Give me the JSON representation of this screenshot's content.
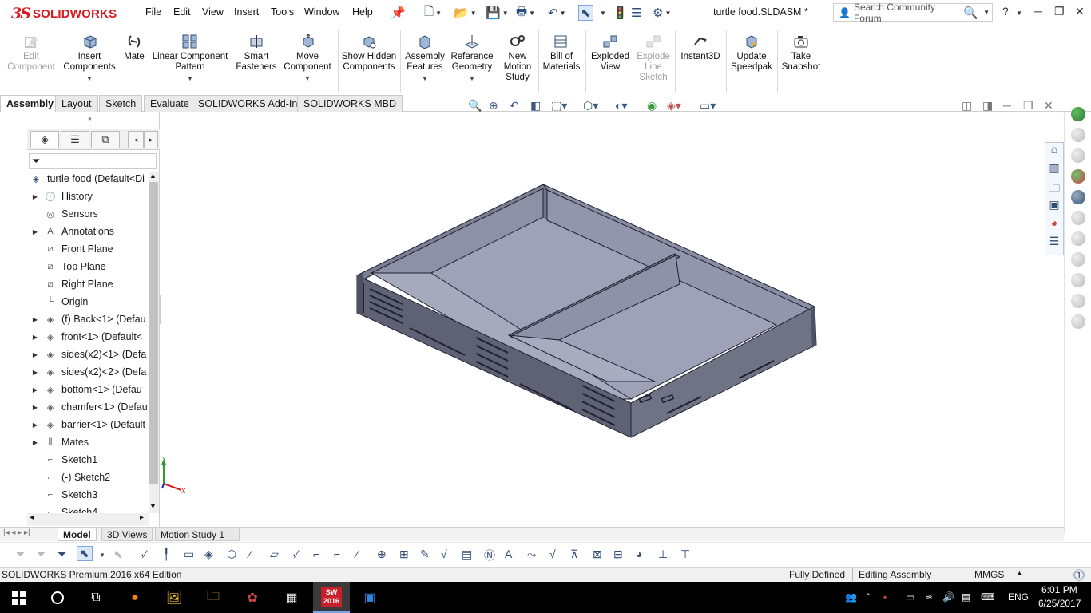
{
  "app": {
    "brand": "SOLIDWORKS",
    "document_title": "turtle food.SLDASM *"
  },
  "menu": [
    "File",
    "Edit",
    "View",
    "Insert",
    "Tools",
    "Window",
    "Help"
  ],
  "search": {
    "placeholder": "Search Community Forum"
  },
  "ribbon": [
    {
      "label": "Edit Component",
      "icon": "edit-component-icon",
      "enabled": false
    },
    {
      "label": "Insert Components",
      "icon": "insert-components-icon",
      "enabled": true
    },
    {
      "label": "Mate",
      "icon": "mate-icon",
      "enabled": true
    },
    {
      "label": "Linear Component Pattern",
      "icon": "pattern-icon",
      "enabled": true
    },
    {
      "label": "Smart Fasteners",
      "icon": "smart-fasteners-icon",
      "enabled": true
    },
    {
      "label": "Move Component",
      "icon": "move-component-icon",
      "enabled": true
    },
    {
      "label": "Show Hidden Components",
      "icon": "show-hidden-icon",
      "enabled": true
    },
    {
      "label": "Assembly Features",
      "icon": "assembly-features-icon",
      "enabled": true
    },
    {
      "label": "Reference Geometry",
      "icon": "reference-geometry-icon",
      "enabled": true
    },
    {
      "label": "New Motion Study",
      "icon": "motion-study-icon",
      "enabled": true
    },
    {
      "label": "Bill of Materials",
      "icon": "bom-icon",
      "enabled": true
    },
    {
      "label": "Exploded View",
      "icon": "exploded-view-icon",
      "enabled": true
    },
    {
      "label": "Explode Line Sketch",
      "icon": "explode-line-icon",
      "enabled": false
    },
    {
      "label": "Instant3D",
      "icon": "instant3d-icon",
      "enabled": true
    },
    {
      "label": "Update Speedpak",
      "icon": "speedpak-icon",
      "enabled": true
    },
    {
      "label": "Take Snapshot",
      "icon": "camera-icon",
      "enabled": true
    }
  ],
  "command_tabs": [
    "Assembly",
    "Layout",
    "Sketch",
    "Evaluate",
    "SOLIDWORKS Add-Ins",
    "SOLIDWORKS MBD"
  ],
  "feature_tree": {
    "root": "turtle food  (Default<Di",
    "items": [
      {
        "label": "History",
        "icon": "history-icon",
        "expandable": true
      },
      {
        "label": "Sensors",
        "icon": "sensors-icon",
        "expandable": false
      },
      {
        "label": "Annotations",
        "icon": "annotations-icon",
        "expandable": true
      },
      {
        "label": "Front Plane",
        "icon": "plane-icon",
        "expandable": false
      },
      {
        "label": "Top Plane",
        "icon": "plane-icon",
        "expandable": false
      },
      {
        "label": "Right Plane",
        "icon": "plane-icon",
        "expandable": false
      },
      {
        "label": "Origin",
        "icon": "origin-icon",
        "expandable": false
      },
      {
        "label": "(f) Back<1> (Defau",
        "icon": "part-icon",
        "expandable": true
      },
      {
        "label": "front<1> (Default<",
        "icon": "part-icon",
        "expandable": true
      },
      {
        "label": "sides(x2)<1> (Defa",
        "icon": "part-icon",
        "expandable": true
      },
      {
        "label": "sides(x2)<2> (Defa",
        "icon": "part-icon",
        "expandable": true
      },
      {
        "label": "bottom<1> (Defau",
        "icon": "part-icon",
        "expandable": true
      },
      {
        "label": "chamfer<1> (Defau",
        "icon": "part-icon",
        "expandable": true
      },
      {
        "label": "barrier<1> (Default",
        "icon": "part-icon",
        "expandable": true
      },
      {
        "label": "Mates",
        "icon": "mates-icon",
        "expandable": true
      },
      {
        "label": "Sketch1",
        "icon": "sketch-icon",
        "expandable": false
      },
      {
        "label": "(-) Sketch2",
        "icon": "sketch-icon",
        "expandable": false
      },
      {
        "label": "Sketch3",
        "icon": "sketch-icon",
        "expandable": false
      },
      {
        "label": "Sketch4",
        "icon": "sketch-icon",
        "expandable": false
      }
    ]
  },
  "bottom_tabs": [
    "Model",
    "3D Views",
    "Motion Study 1"
  ],
  "status": {
    "edition": "SOLIDWORKS Premium 2016 x64 Edition",
    "defined": "Fully Defined",
    "mode": "Editing Assembly",
    "units": "MMGS"
  },
  "taskbar": {
    "lang": "ENG",
    "time": "6:01 PM",
    "date": "6/25/2017",
    "sw_badge": "2016"
  },
  "colors": {
    "brand": "#d71920",
    "model_face": "#9b9fb5",
    "model_dark": "#63667a",
    "model_edge": "#1f2030"
  }
}
